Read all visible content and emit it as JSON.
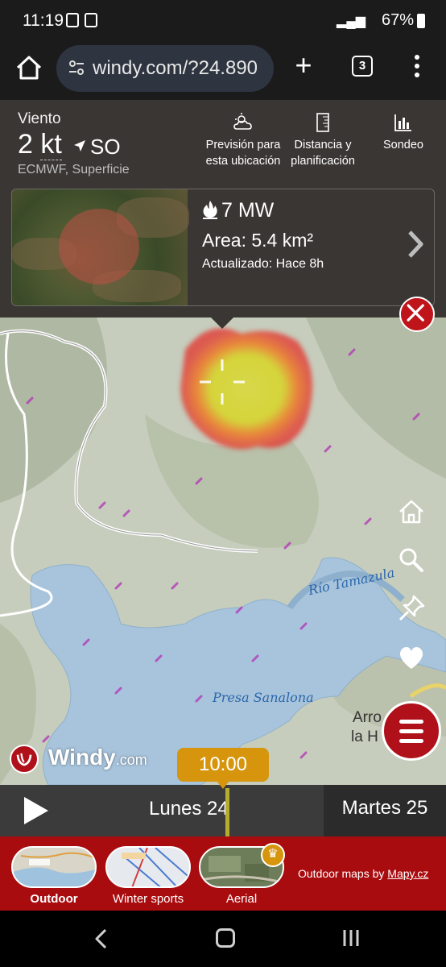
{
  "status_bar": {
    "time": "11:19",
    "battery": "67%"
  },
  "browser": {
    "url": "windy.com/?24.890",
    "tab_count": "3"
  },
  "wind": {
    "label": "Viento",
    "speed_value": "2",
    "speed_unit": "kt",
    "direction": "SO",
    "model": "ECMWF, Superficie"
  },
  "header_buttons": {
    "forecast": "Previsión para esta ubicación",
    "distance": "Distancia y planificación",
    "sounding": "Sondeo"
  },
  "fire": {
    "power": "7 MW",
    "area": "Area: 5.4 km²",
    "updated": "Actualizado: Hace 8h"
  },
  "map": {
    "river_label": "Río Tamazula",
    "lake_label": "Presa Sanalona",
    "town_label_1": "Arro",
    "town_label_2": "la H",
    "brand": "Windy",
    "brand_suffix": "com"
  },
  "timeline": {
    "time": "10:00",
    "day_current": "Lunes 24",
    "day_next": "Martes 25"
  },
  "layers": [
    {
      "label": "Outdoor",
      "selected": true
    },
    {
      "label": "Winter sports",
      "selected": false
    },
    {
      "label": "Aerial",
      "selected": false,
      "premium": true
    }
  ],
  "layers_credit_prefix": "Outdoor maps by",
  "layers_credit_link": "Mapy.cz",
  "colors": {
    "accent_red": "#b0101a",
    "time_orange": "#d6950c",
    "panel_bg": "#3a3634",
    "layerbar_bg": "#a90c0f"
  },
  "icons": [
    "home-icon",
    "tune-icon",
    "plus-icon",
    "tabs-icon",
    "more-icon",
    "wind-arrow-icon",
    "weather-icon",
    "ruler-icon",
    "chart-icon",
    "fire-icon",
    "chevron-right-icon",
    "close-icon",
    "home-map-icon",
    "search-icon",
    "pin-icon",
    "heart-icon",
    "menu-icon",
    "play-icon",
    "crown-icon",
    "back-icon",
    "recent-icon"
  ]
}
